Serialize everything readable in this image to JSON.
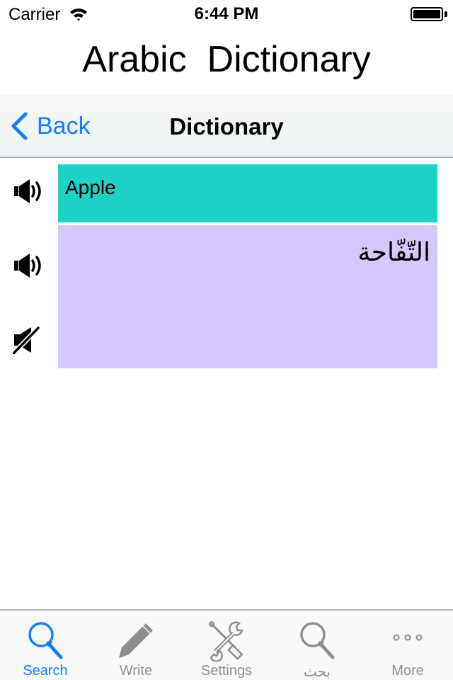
{
  "status_bar": {
    "carrier": "Carrier",
    "time": "6:44 PM",
    "wifi_icon": "wifi-icon",
    "battery_icon": "battery-full-icon"
  },
  "app": {
    "title": "Arabic  Dictionary"
  },
  "nav_bar": {
    "back_label": "Back",
    "back_icon": "chevron-left-icon",
    "title": "Dictionary"
  },
  "entry": {
    "english_word": "Apple",
    "arabic_word": "التّفّاحة",
    "english_box_color": "#1dd1c4",
    "arabic_box_color": "#d5c8fc",
    "controls": [
      {
        "icon": "speaker-icon",
        "action": "play-english"
      },
      {
        "icon": "speaker-icon",
        "action": "play-arabic"
      },
      {
        "icon": "speaker-muted-icon",
        "action": "mute"
      }
    ]
  },
  "tab_bar": {
    "active_color": "#157efb",
    "inactive_color": "#929292",
    "tabs": [
      {
        "label": "Search",
        "icon": "search-icon",
        "active": true
      },
      {
        "label": "Write",
        "icon": "pencil-icon",
        "active": false
      },
      {
        "label": "Settings",
        "icon": "tools-icon",
        "active": false
      },
      {
        "label": "بحث",
        "icon": "search-icon",
        "active": false
      },
      {
        "label": "More",
        "icon": "more-icon",
        "active": false
      }
    ]
  }
}
